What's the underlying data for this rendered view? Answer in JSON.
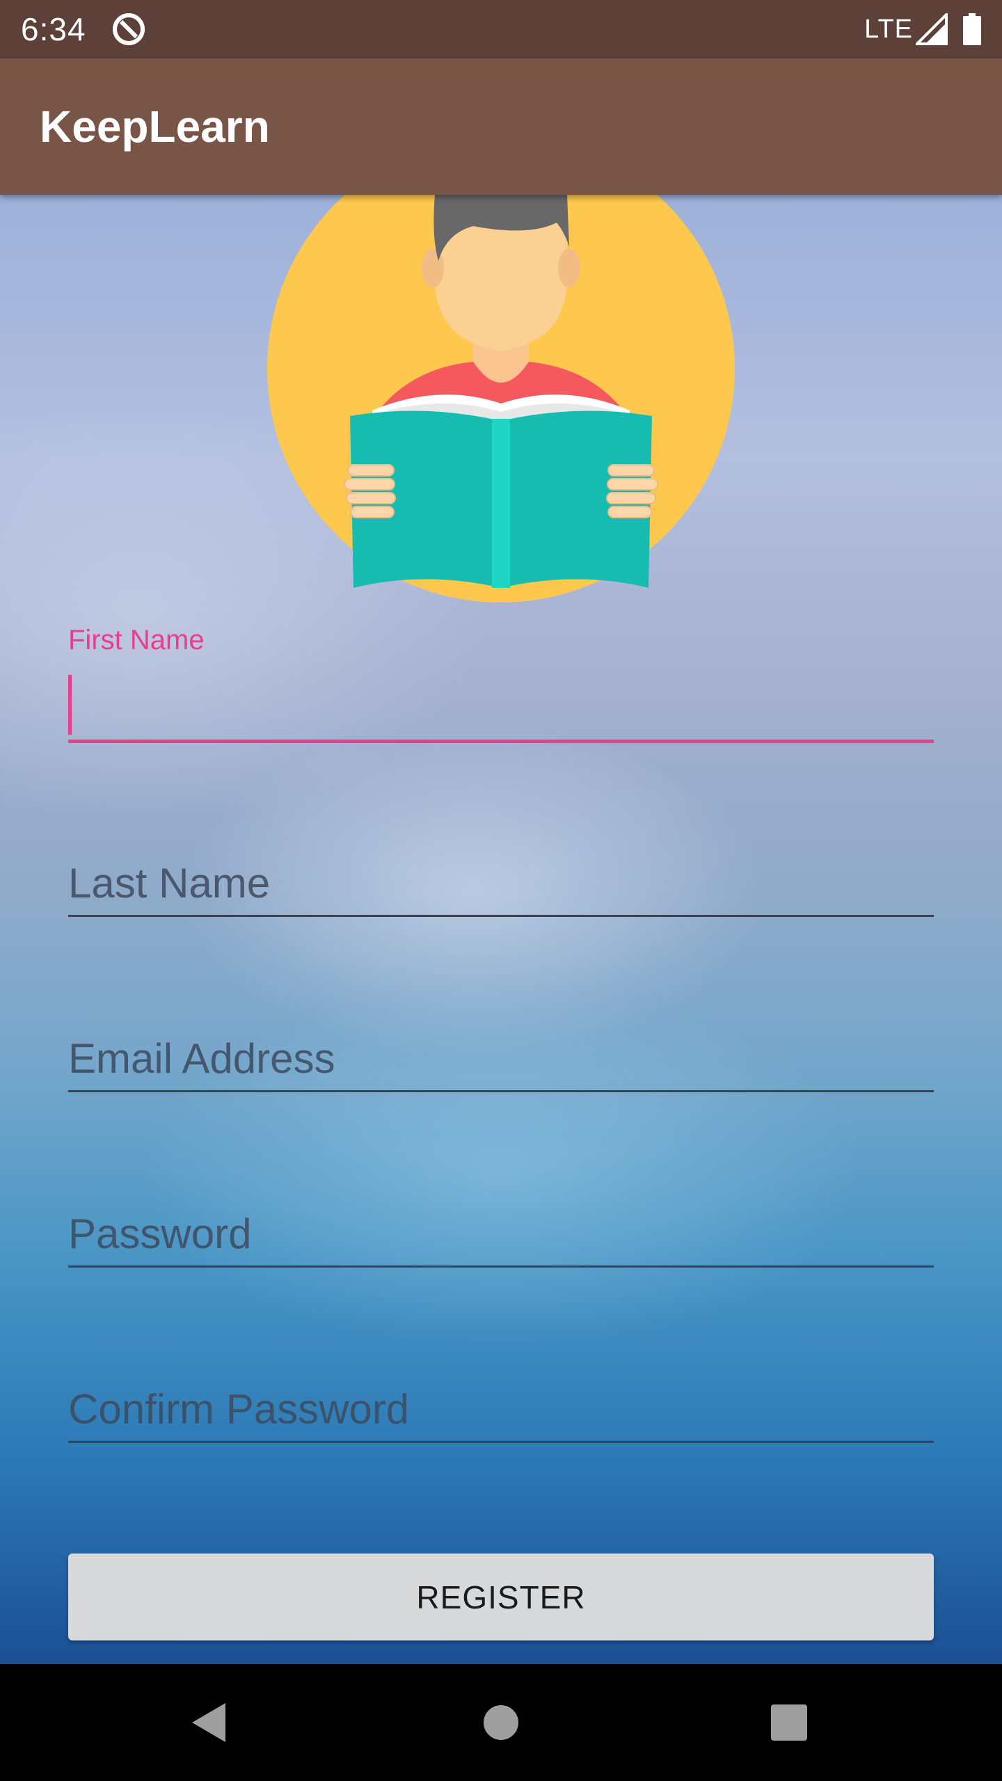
{
  "status_bar": {
    "time": "6:34",
    "network": "LTE",
    "icons": [
      "do-not-disturb-icon",
      "signal-icon",
      "battery-icon"
    ]
  },
  "app_bar": {
    "title": "KeepLearn"
  },
  "hero": {
    "image": "reading-student-illustration"
  },
  "form": {
    "first_name": {
      "label": "First Name",
      "value": ""
    },
    "last_name": {
      "placeholder": "Last Name",
      "value": ""
    },
    "email": {
      "placeholder": "Email Address",
      "value": ""
    },
    "password": {
      "placeholder": "Password",
      "value": ""
    },
    "confirm_password": {
      "placeholder": "Confirm Password",
      "value": ""
    }
  },
  "register_button": {
    "label": "REGISTER"
  },
  "nav_bar": {
    "icons": [
      "back-icon",
      "home-icon",
      "recents-icon"
    ]
  },
  "colors": {
    "status_bar": "#5d4037",
    "app_bar": "#795548",
    "accent": "#e83e8c",
    "button": "#d8d9da"
  }
}
